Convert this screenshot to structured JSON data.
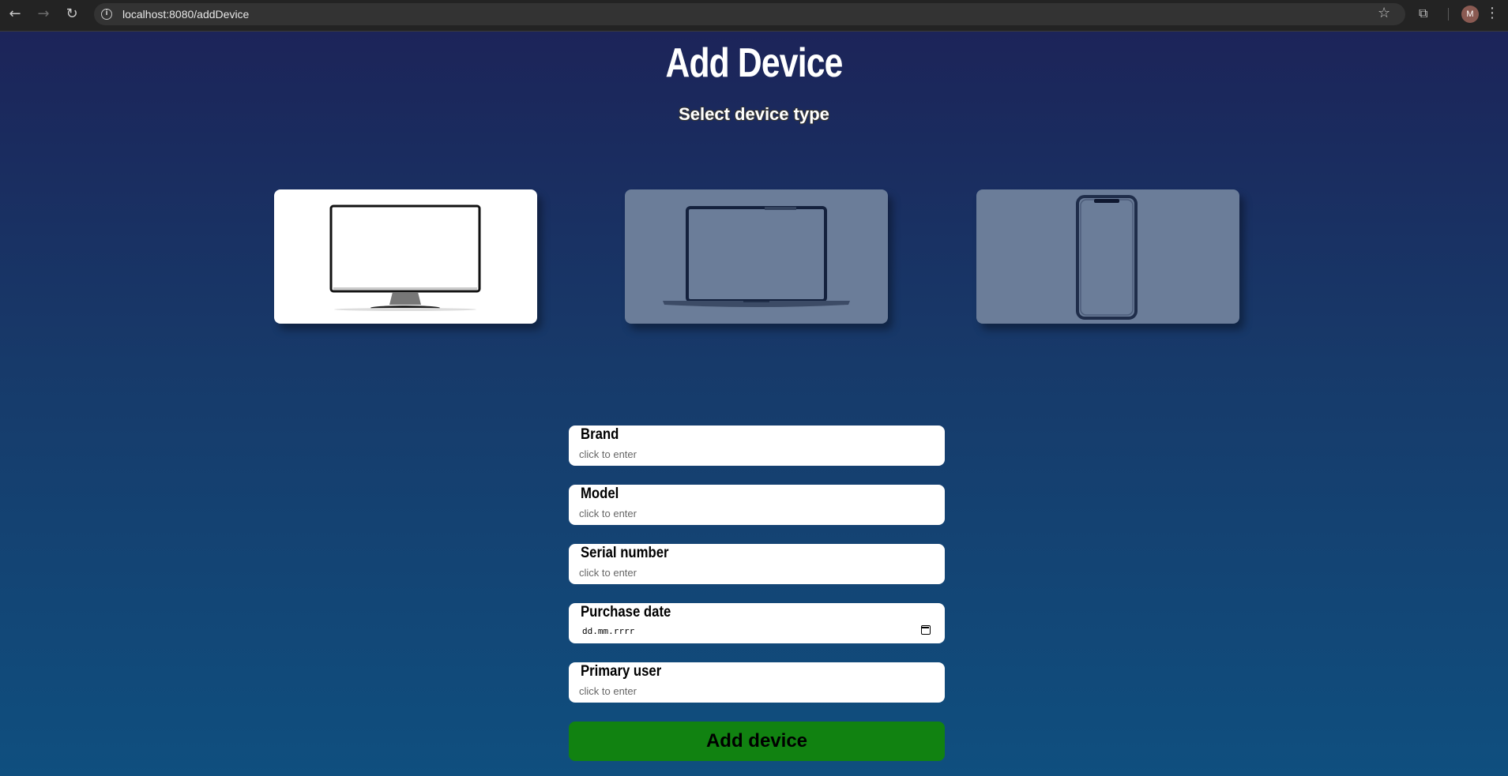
{
  "browser": {
    "url_host": "localhost:8080",
    "url_path": "/addDevice",
    "avatar_initial": "M",
    "icons": [
      "back-icon",
      "forward-icon",
      "reload-icon",
      "info-icon",
      "star-icon",
      "extensions-icon",
      "menu-icon"
    ]
  },
  "header": {
    "title": "Add Device",
    "subtitle": "Select device type"
  },
  "device_types": [
    {
      "name": "desktop-monitor",
      "selected": true
    },
    {
      "name": "laptop",
      "selected": false
    },
    {
      "name": "smartphone",
      "selected": false
    }
  ],
  "form": {
    "brand": {
      "label": "Brand",
      "placeholder": "click to enter"
    },
    "model": {
      "label": "Model",
      "placeholder": "click to enter"
    },
    "serial": {
      "label": "Serial number",
      "placeholder": "click to enter"
    },
    "purchase_date": {
      "label": "Purchase date",
      "placeholder": "dd.mm.rrrr"
    },
    "primary_user": {
      "label": "Primary user",
      "placeholder": "click to enter"
    },
    "submit_label": "Add device"
  },
  "colors": {
    "submit_bg": "#118211",
    "card_selected": "#ffffff",
    "card_unselected": "#6b7d99"
  }
}
